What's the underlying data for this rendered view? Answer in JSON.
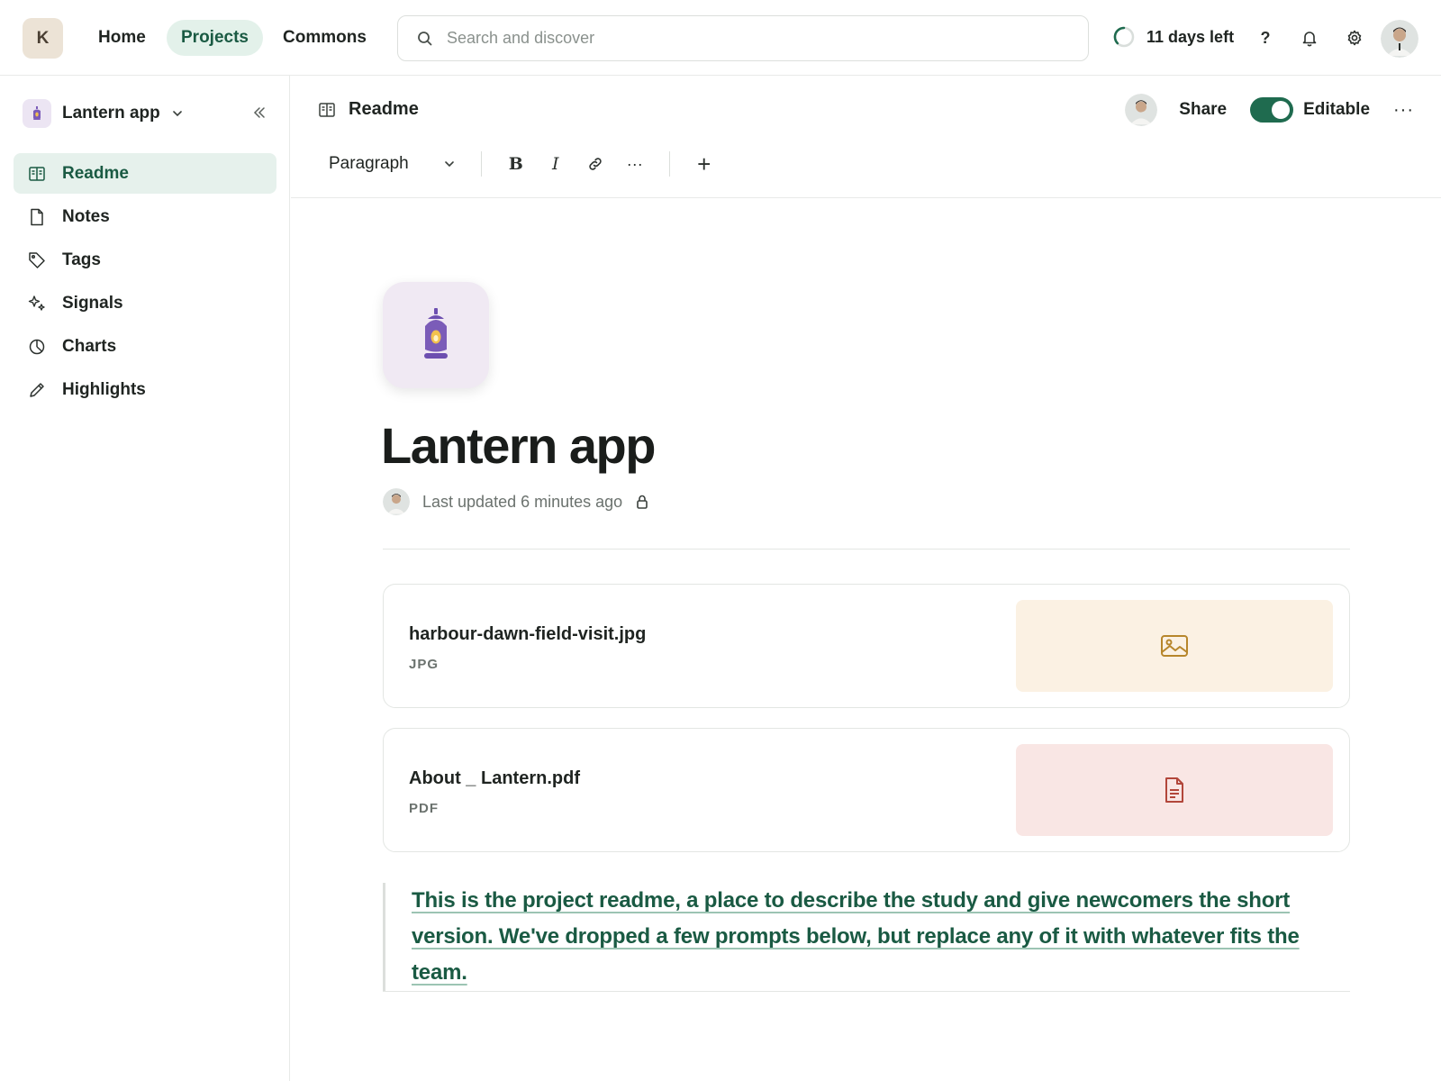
{
  "workspace": {
    "initial": "K"
  },
  "nav": {
    "home": "Home",
    "projects": "Projects",
    "commons": "Commons"
  },
  "search": {
    "placeholder": "Search and discover"
  },
  "trial": {
    "label": "11 days left"
  },
  "help": {
    "label": "?"
  },
  "sidebar": {
    "project_name": "Lantern app",
    "items": [
      {
        "label": "Readme",
        "icon": "book-open-icon",
        "active": true
      },
      {
        "label": "Notes",
        "icon": "file-icon"
      },
      {
        "label": "Tags",
        "icon": "tag-icon"
      },
      {
        "label": "Signals",
        "icon": "sparkles-icon"
      },
      {
        "label": "Charts",
        "icon": "pie-chart-icon"
      },
      {
        "label": "Highlights",
        "icon": "pencil-icon"
      }
    ]
  },
  "doc_header": {
    "title": "Readme",
    "share_label": "Share",
    "editable_label": "Editable",
    "editable": true,
    "more_label": "···"
  },
  "toolbar": {
    "block_type": "Paragraph",
    "bold": "B",
    "italic": "I",
    "more": "···",
    "add": "+"
  },
  "document": {
    "title": "Lantern app",
    "meta": "Last updated 6 minutes ago",
    "files": [
      {
        "name": "harbour-dawn-field-visit.jpg",
        "type": "JPG",
        "icon": "image-icon",
        "color": "#b7862b"
      },
      {
        "name": "About _ Lantern.pdf",
        "type": "PDF",
        "icon": "document-icon",
        "color": "#b2463a"
      }
    ],
    "quote": "This is the project readme, a place to describe the study and give newcomers the short version. We've dropped a few prompts below, but replace any of it with whatever fits the team."
  },
  "colors": {
    "accent": "#1a5a43",
    "toggle_on": "#1f6b4f",
    "nav_active_bg": "#e3f1ea",
    "lantern_purple": "#7b5cb8"
  }
}
